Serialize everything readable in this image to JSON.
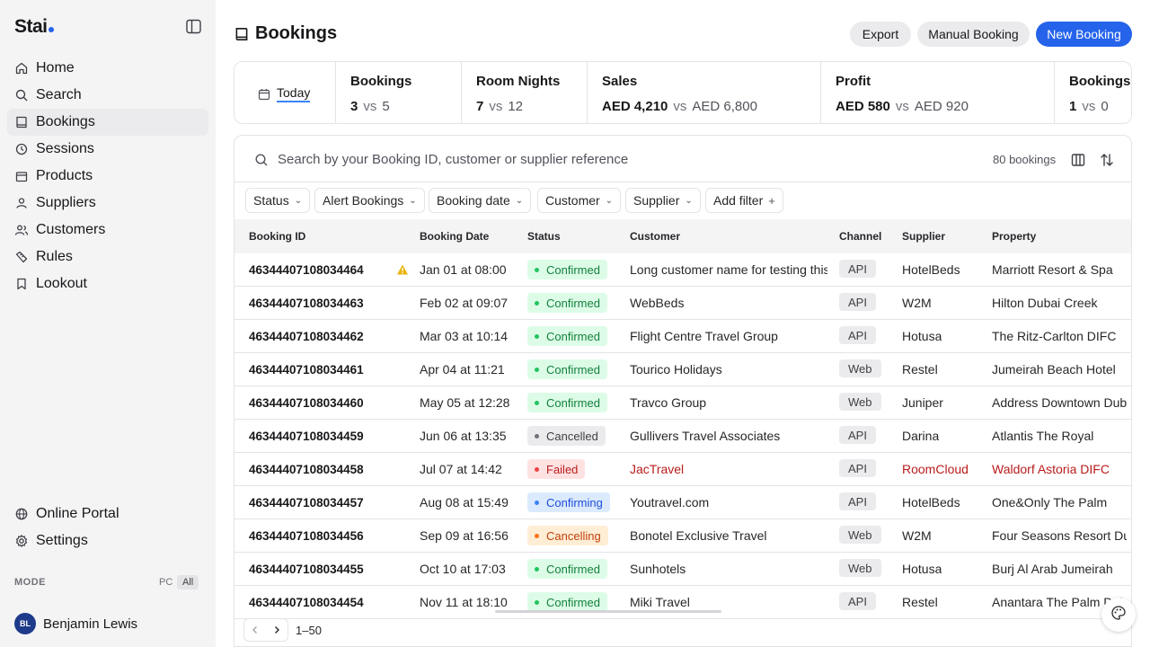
{
  "app": {
    "logo_text": "Stai"
  },
  "sidebar": {
    "items": [
      {
        "label": "Home",
        "icon": "home-icon",
        "active": false
      },
      {
        "label": "Search",
        "icon": "search-icon",
        "active": false
      },
      {
        "label": "Bookings",
        "icon": "book-icon",
        "active": true
      },
      {
        "label": "Sessions",
        "icon": "sessions-icon",
        "active": false
      },
      {
        "label": "Products",
        "icon": "box-icon",
        "active": false
      },
      {
        "label": "Suppliers",
        "icon": "suppliers-icon",
        "active": false
      },
      {
        "label": "Customers",
        "icon": "users-icon",
        "active": false
      },
      {
        "label": "Rules",
        "icon": "rules-icon",
        "active": false
      },
      {
        "label": "Lookout",
        "icon": "lookout-icon",
        "active": false
      }
    ],
    "bottom_items": [
      {
        "label": "Online Portal",
        "icon": "portal-icon"
      },
      {
        "label": "Settings",
        "icon": "gear-icon"
      }
    ],
    "mode": {
      "label": "MODE",
      "options": [
        "PC",
        "All"
      ],
      "selected": "All"
    },
    "user": {
      "initials": "BL",
      "name": "Benjamin Lewis"
    }
  },
  "header": {
    "title": "Bookings",
    "export_label": "Export",
    "manual_label": "Manual Booking",
    "new_label": "New Booking"
  },
  "stats": {
    "period_label": "Today",
    "vs": "vs",
    "cards": [
      {
        "title": "Bookings",
        "current": "3",
        "previous": "5"
      },
      {
        "title": "Room Nights",
        "current": "7",
        "previous": "12"
      },
      {
        "title": "Sales",
        "current": "AED 4,210",
        "previous": "AED 6,800"
      },
      {
        "title": "Profit",
        "current": "AED 580",
        "previous": "AED 920"
      },
      {
        "title": "Bookings C",
        "current": "1",
        "previous": "0"
      }
    ]
  },
  "table": {
    "search_placeholder": "Search by your Booking ID, customer or supplier reference",
    "count_label": "80 bookings",
    "filters": [
      "Status",
      "Alert Bookings",
      "Booking date",
      "Customer",
      "Supplier"
    ],
    "add_filter_label": "Add filter",
    "columns": [
      "Booking ID",
      "Booking Date",
      "Status",
      "Customer",
      "Channel",
      "Supplier",
      "Property"
    ],
    "rows": [
      {
        "id": "46344407108034464",
        "warn": true,
        "date": "Jan 01 at 08:00",
        "status": "Confirmed",
        "customer": "Long customer name for testing this",
        "channel": "API",
        "supplier": "HotelBeds",
        "property": "Marriott Resort & Spa"
      },
      {
        "id": "46344407108034463",
        "warn": false,
        "date": "Feb 02 at 09:07",
        "status": "Confirmed",
        "customer": "WebBeds",
        "channel": "API",
        "supplier": "W2M",
        "property": "Hilton Dubai Creek"
      },
      {
        "id": "46344407108034462",
        "warn": false,
        "date": "Mar 03 at 10:14",
        "status": "Confirmed",
        "customer": "Flight Centre Travel Group",
        "channel": "API",
        "supplier": "Hotusa",
        "property": "The Ritz-Carlton DIFC"
      },
      {
        "id": "46344407108034461",
        "warn": false,
        "date": "Apr 04 at 11:21",
        "status": "Confirmed",
        "customer": "Tourico Holidays",
        "channel": "Web",
        "supplier": "Restel",
        "property": "Jumeirah Beach Hotel"
      },
      {
        "id": "46344407108034460",
        "warn": false,
        "date": "May 05 at 12:28",
        "status": "Confirmed",
        "customer": "Travco Group",
        "channel": "Web",
        "supplier": "Juniper",
        "property": "Address Downtown Dubai"
      },
      {
        "id": "46344407108034459",
        "warn": false,
        "date": "Jun 06 at 13:35",
        "status": "Cancelled",
        "customer": "Gullivers Travel Associates",
        "channel": "API",
        "supplier": "Darina",
        "property": "Atlantis The Royal"
      },
      {
        "id": "46344407108034458",
        "warn": false,
        "date": "Jul 07 at 14:42",
        "status": "Failed",
        "customer": "JacTravel",
        "channel": "API",
        "supplier": "RoomCloud",
        "property": "Waldorf Astoria DIFC"
      },
      {
        "id": "46344407108034457",
        "warn": false,
        "date": "Aug 08 at 15:49",
        "status": "Confirming",
        "customer": "Youtravel.com",
        "channel": "API",
        "supplier": "HotelBeds",
        "property": "One&Only The Palm"
      },
      {
        "id": "46344407108034456",
        "warn": false,
        "date": "Sep 09 at 16:56",
        "status": "Cancelling",
        "customer": "Bonotel Exclusive Travel",
        "channel": "Web",
        "supplier": "W2M",
        "property": "Four Seasons Resort Dubai"
      },
      {
        "id": "46344407108034455",
        "warn": false,
        "date": "Oct 10 at 17:03",
        "status": "Confirmed",
        "customer": "Sunhotels",
        "channel": "Web",
        "supplier": "Hotusa",
        "property": "Burj Al Arab Jumeirah"
      },
      {
        "id": "46344407108034454",
        "warn": false,
        "date": "Nov 11 at 18:10",
        "status": "Confirmed",
        "customer": "Miki Travel",
        "channel": "API",
        "supplier": "Restel",
        "property": "Anantara The Palm Dubai"
      }
    ],
    "pagination": {
      "range": "1–50"
    }
  },
  "colors": {
    "accent": "#2563eb",
    "confirmed_bg": "#dcfce7",
    "confirmed_fg": "#15803d",
    "confirmed_dot": "#22c55e",
    "cancelled_bg": "#ebebed",
    "cancelled_fg": "#3f3f46",
    "cancelled_dot": "#71717a",
    "failed_bg": "#fee2e2",
    "failed_fg": "#b91c1c",
    "failed_dot": "#ef4444",
    "confirming_bg": "#dbeafe",
    "confirming_fg": "#1d4ed8",
    "confirming_dot": "#3b82f6",
    "cancelling_bg": "#ffedd5",
    "cancelling_fg": "#c2410c",
    "cancelling_dot": "#f97316"
  }
}
